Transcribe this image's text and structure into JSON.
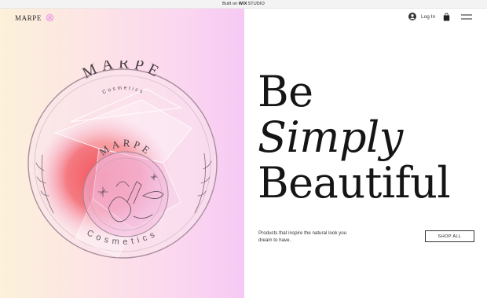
{
  "banner": {
    "prefix": "Built on",
    "wix": "WIX",
    "studio": "STUDIO"
  },
  "header": {
    "brand": "MARPE",
    "login_label": "Log In"
  },
  "icons": {
    "flower": "flower-icon",
    "user": "user-icon",
    "cart": "shopping-bag-icon",
    "menu": "hamburger-menu-icon"
  },
  "hero": {
    "line1": "Be",
    "line2": "Simply",
    "line3": "Beautiful",
    "tagline": "Products that inspire the natural look you dream to have.",
    "cta": "SHOP ALL"
  },
  "logo": {
    "outer_title": "MARPE",
    "outer_subtitle": "Cosmetics",
    "inner_title": "MARPE",
    "inner_subtitle": "Cosmetics"
  },
  "colors": {
    "left_gradient_start": "#fcf1d9",
    "left_gradient_end": "#f6c9f4",
    "logo_red": "#f25a5e",
    "logo_pink": "#f7b3d8",
    "text_dark": "#151515"
  }
}
